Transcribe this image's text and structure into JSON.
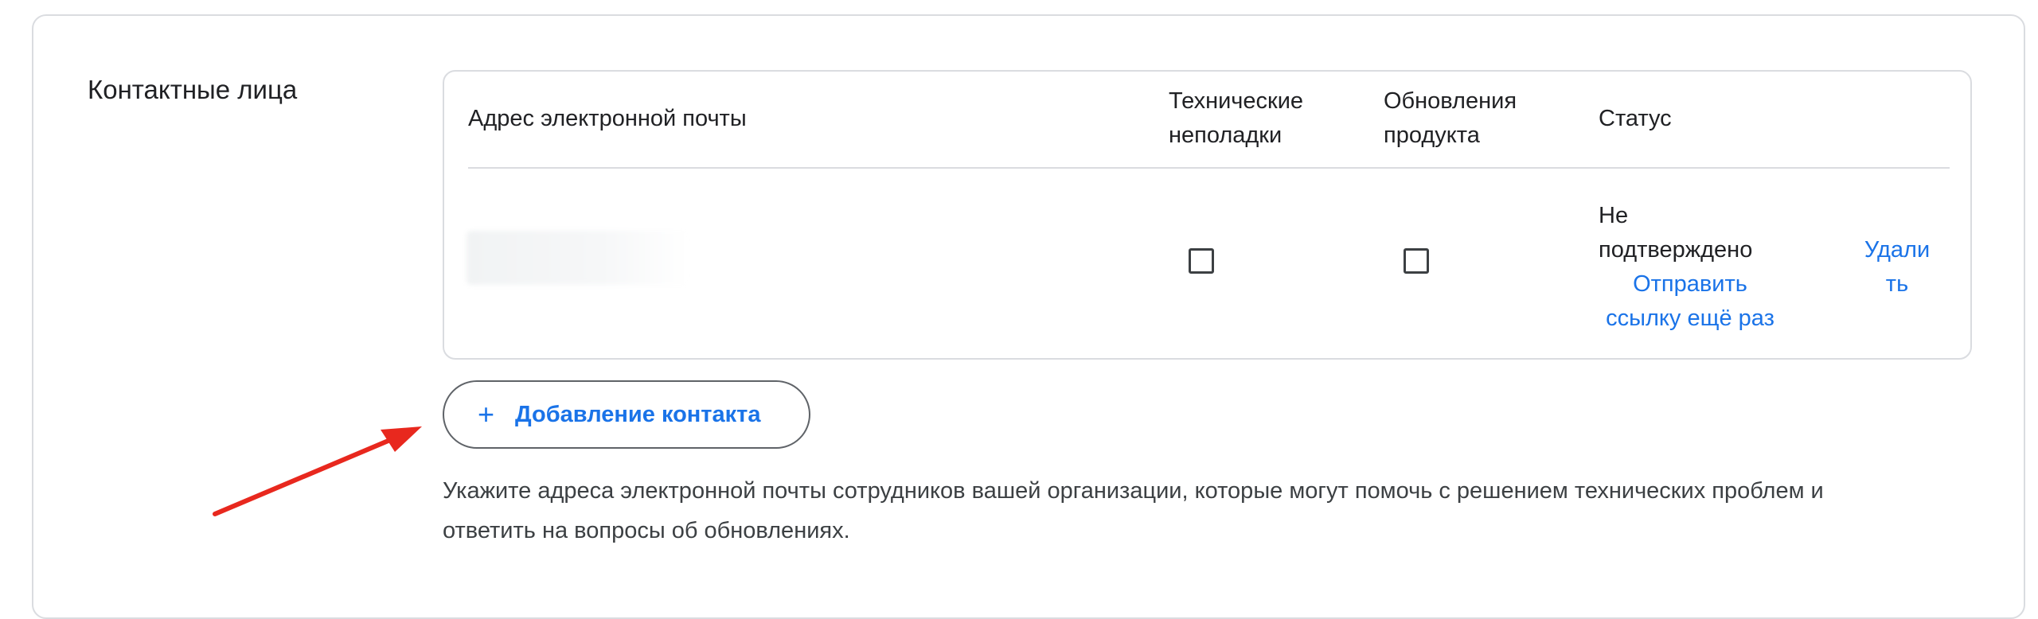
{
  "section": {
    "title": "Контактные лица"
  },
  "table": {
    "headers": {
      "email": "Адрес электронной почты",
      "tech_line1": "Технические",
      "tech_line2": "неполадки",
      "updates_line1": "Обновления",
      "updates_line2": "продукта",
      "status": "Статус"
    },
    "rows": [
      {
        "email": "",
        "tech_issues_checked": false,
        "product_updates_checked": false,
        "status_line1": "Не",
        "status_line2": "подтверждено",
        "resend_line1": "Отправить",
        "resend_line2": "ссылку ещё раз",
        "delete_line1": "Удали",
        "delete_line2": "ть"
      }
    ]
  },
  "add_contact": {
    "icon": "plus-icon",
    "plus_glyph": "+",
    "label": "Добавление контакта"
  },
  "help_text": {
    "line1": "Укажите адреса электронной почты сотрудников вашей организации, которые могут помочь с решением технических проблем и",
    "line2": "ответить на вопросы об обновлениях."
  },
  "colors": {
    "accent": "#1a73e8",
    "annotation_arrow": "#e8281e",
    "border": "#dadce0"
  }
}
